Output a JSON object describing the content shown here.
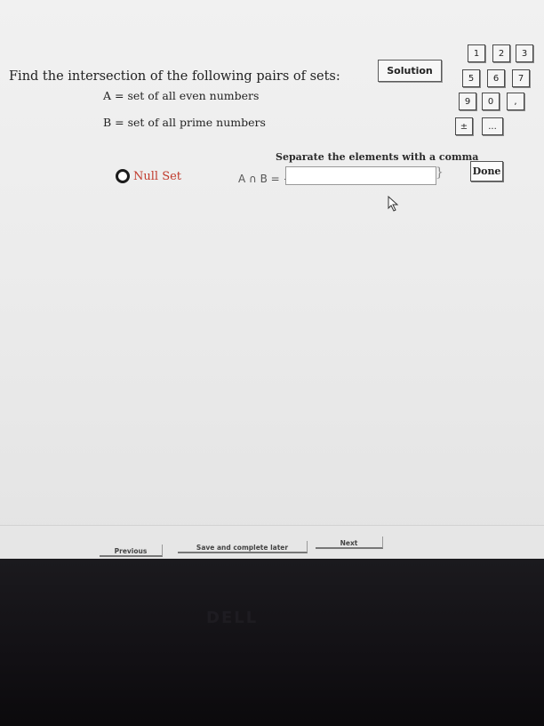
{
  "question": {
    "title": "Find the intersection of the following pairs of sets:",
    "set_a": "A = set of all even numbers",
    "set_b": "B = set of all prime numbers"
  },
  "toolbar": {
    "solution_label": "Solution"
  },
  "keypad": {
    "keys": [
      "1",
      "2",
      "3",
      "5",
      "6",
      "7",
      "9",
      "0",
      ",",
      "±",
      "..."
    ]
  },
  "answer": {
    "hint": "Separate the elements with a comma",
    "null_set_label": "Null Set",
    "expression": "A ∩ B = {",
    "close_brace": "}",
    "value": ""
  },
  "buttons": {
    "done_label": "Done",
    "previous_label": "Previous",
    "save_label": "Save and complete later",
    "next_label": "Next"
  },
  "brand": {
    "logo": "DELL"
  },
  "colors": {
    "null_set_text": "#c0392b"
  }
}
